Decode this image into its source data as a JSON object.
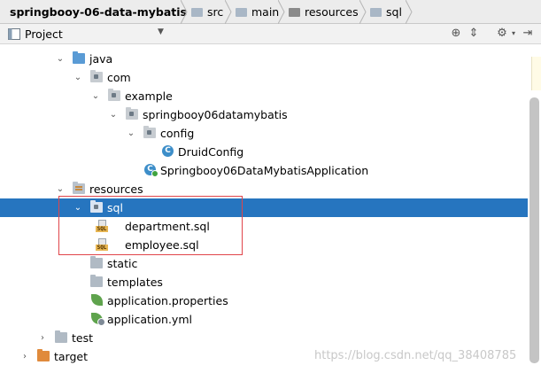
{
  "breadcrumb": {
    "items": [
      {
        "label": "springbooy-06-data-mybatis",
        "icon": "project-icon"
      },
      {
        "label": "src",
        "icon": "folder-icon"
      },
      {
        "label": "main",
        "icon": "folder-icon"
      },
      {
        "label": "resources",
        "icon": "resources-folder-icon"
      },
      {
        "label": "sql",
        "icon": "folder-icon"
      }
    ]
  },
  "toolwindow": {
    "title": "Project",
    "dropdown_glyph": "▼",
    "icons": [
      "target-icon",
      "collapse-all-icon",
      "settings-icon",
      "hide-icon"
    ]
  },
  "tree": {
    "rows": [
      {
        "label": "java",
        "icon": "source-folder-icon",
        "expanded": true
      },
      {
        "label": "com",
        "icon": "package-icon",
        "expanded": true
      },
      {
        "label": "example",
        "icon": "package-icon",
        "expanded": true
      },
      {
        "label": "springbooy06datamybatis",
        "icon": "package-icon",
        "expanded": true
      },
      {
        "label": "config",
        "icon": "package-icon",
        "expanded": true
      },
      {
        "label": "DruidConfig",
        "icon": "class-icon",
        "badge": "C"
      },
      {
        "label": "Springbooy06DataMybatisApplication",
        "icon": "spring-app-class-icon",
        "badge": "C"
      },
      {
        "label": "resources",
        "icon": "resources-folder-icon",
        "expanded": true
      },
      {
        "label": "sql",
        "icon": "folder-icon",
        "expanded": true,
        "selected": true
      },
      {
        "label": "department.sql",
        "icon": "sql-file-icon",
        "badge": "SQL"
      },
      {
        "label": "employee.sql",
        "icon": "sql-file-icon",
        "badge": "SQL"
      },
      {
        "label": "static",
        "icon": "folder-icon"
      },
      {
        "label": "templates",
        "icon": "folder-icon"
      },
      {
        "label": "application.properties",
        "icon": "spring-properties-icon"
      },
      {
        "label": "application.yml",
        "icon": "spring-yml-icon"
      },
      {
        "label": "test",
        "icon": "folder-icon",
        "expanded": false
      },
      {
        "label": "target",
        "icon": "excluded-folder-icon",
        "expanded": false
      }
    ]
  },
  "selection_color": "#2675bf",
  "highlight_color": "#e0454a",
  "watermark": "https://blog.csdn.net/qq_38408785"
}
